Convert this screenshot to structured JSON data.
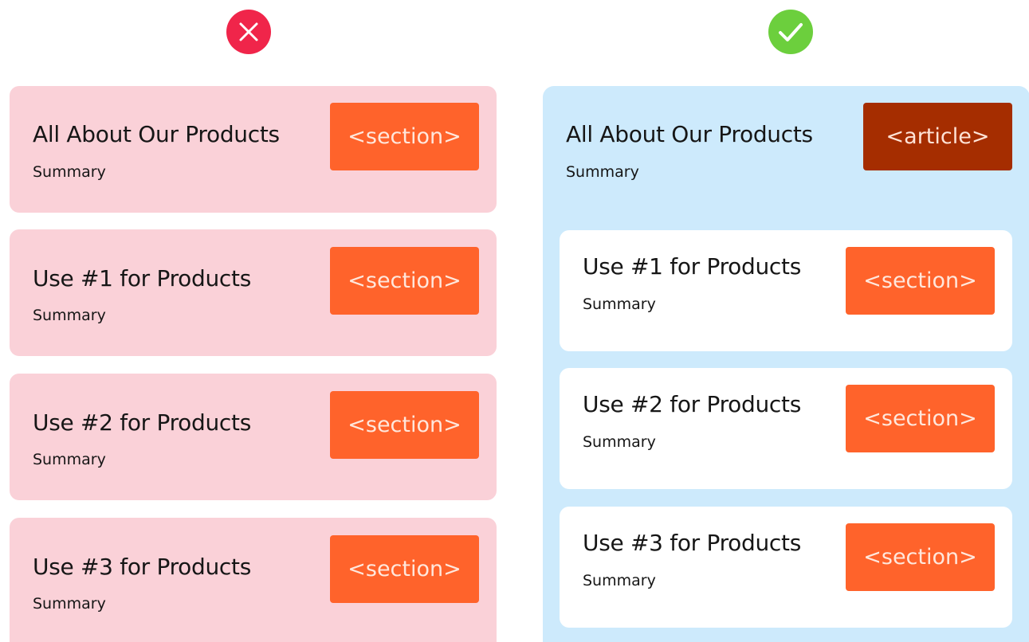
{
  "colors": {
    "bad_icon": "#f0254a",
    "good_icon": "#6ccf3d",
    "bad_card": "#fad1d8",
    "article_card": "#cdeafc",
    "inner_card": "#ffffff",
    "section_tag": "#ff632b",
    "section_tag_text": "#ffe7dc",
    "article_tag": "#a52d00",
    "article_tag_text": "#ffe3d6"
  },
  "icons": {
    "bad": "close-icon",
    "good": "check-icon"
  },
  "left": {
    "cards": [
      {
        "title": "All About Our Products",
        "summary": "Summary",
        "tag": "<section>"
      },
      {
        "title": "Use #1 for Products",
        "summary": "Summary",
        "tag": "<section>"
      },
      {
        "title": "Use #2 for Products",
        "summary": "Summary",
        "tag": "<section>"
      },
      {
        "title": "Use #3 for Products",
        "summary": "Summary",
        "tag": "<section>"
      }
    ]
  },
  "right": {
    "article": {
      "title": "All About Our Products",
      "summary": "Summary",
      "tag": "<article>"
    },
    "sections": [
      {
        "title": "Use #1 for Products",
        "summary": "Summary",
        "tag": "<section>"
      },
      {
        "title": "Use #2 for Products",
        "summary": "Summary",
        "tag": "<section>"
      },
      {
        "title": "Use #3 for Products",
        "summary": "Summary",
        "tag": "<section>"
      }
    ]
  }
}
